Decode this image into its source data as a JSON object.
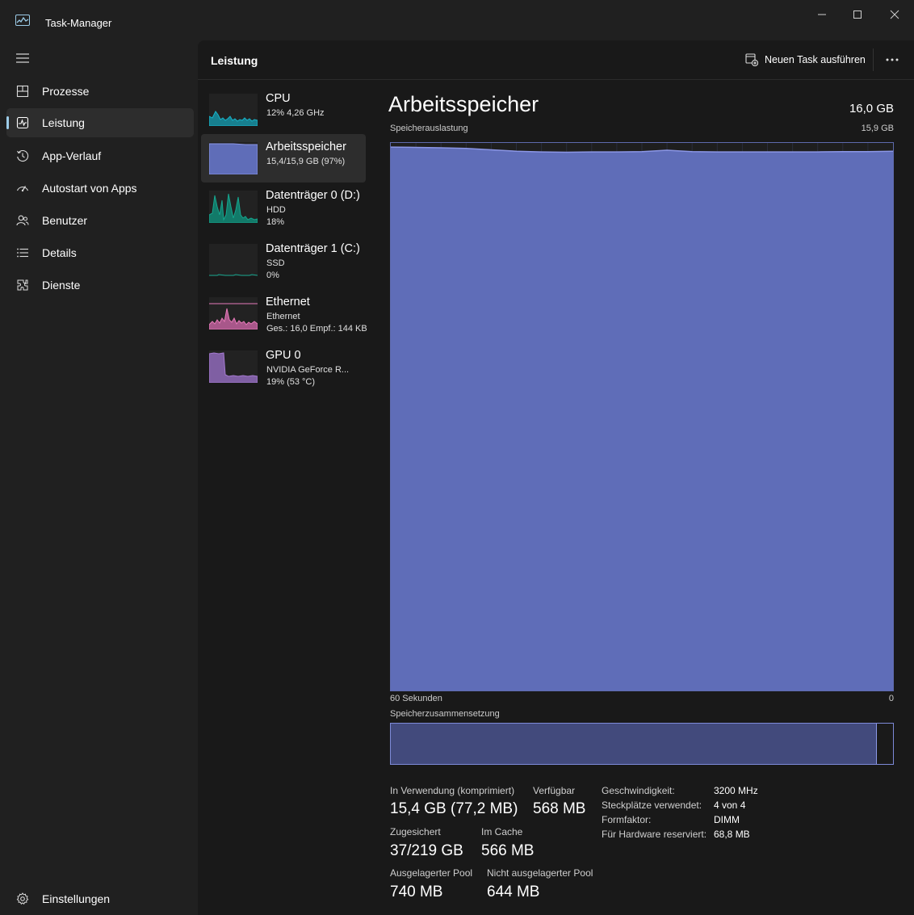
{
  "window": {
    "title": "Task-Manager",
    "icon": "task-manager-icon"
  },
  "sidebar": {
    "items": [
      {
        "label": "Prozesse",
        "icon": "processes-icon"
      },
      {
        "label": "Leistung",
        "icon": "performance-icon",
        "active": true
      },
      {
        "label": "App-Verlauf",
        "icon": "history-icon"
      },
      {
        "label": "Autostart von Apps",
        "icon": "startup-icon"
      },
      {
        "label": "Benutzer",
        "icon": "users-icon"
      },
      {
        "label": "Details",
        "icon": "details-icon"
      },
      {
        "label": "Dienste",
        "icon": "services-icon"
      }
    ],
    "settings": {
      "label": "Einstellungen",
      "icon": "gear-icon"
    }
  },
  "header": {
    "title": "Leistung",
    "new_task_label": "Neuen Task ausführen"
  },
  "resources": [
    {
      "name": "CPU",
      "sub1": "12%  4,26 GHz",
      "sub2": "",
      "color": "#17b3c8"
    },
    {
      "name": "Arbeitsspeicher",
      "sub1": "15,4/15,9 GB (97%)",
      "sub2": "",
      "color": "#6f7ee0"
    },
    {
      "name": "Datenträger 0 (D:)",
      "sub1": "HDD",
      "sub2": "18%",
      "color": "#16a58e"
    },
    {
      "name": "Datenträger 1 (C:)",
      "sub1": "SSD",
      "sub2": "0%",
      "color": "#16a58e"
    },
    {
      "name": "Ethernet",
      "sub1": "Ethernet",
      "sub2": "Ges.: 16,0 Empf.: 144 KB",
      "color": "#e77ab9"
    },
    {
      "name": "GPU 0",
      "sub1": "NVIDIA GeForce R...",
      "sub2": "19%  (53 °C)",
      "color": "#a57bd1"
    }
  ],
  "detail": {
    "title": "Arbeitsspeicher",
    "total": "16,0 GB",
    "graph_label": "Speicherauslastung",
    "graph_max": "15,9 GB",
    "time_left": "60 Sekunden",
    "time_right": "0",
    "composition_label": "Speicherzusammensetzung",
    "composition_used_fraction": 0.968,
    "fill_color": "#5f6db8",
    "line_color": "#8b96e6"
  },
  "chart_data": {
    "type": "area",
    "x": [
      60,
      57,
      54,
      51,
      48,
      45,
      42,
      39,
      36,
      33,
      30,
      27,
      24,
      21,
      18,
      15,
      12,
      9,
      6,
      3,
      0
    ],
    "values": [
      15.78,
      15.77,
      15.76,
      15.74,
      15.7,
      15.66,
      15.64,
      15.63,
      15.64,
      15.64,
      15.65,
      15.69,
      15.65,
      15.64,
      15.64,
      15.64,
      15.64,
      15.64,
      15.65,
      15.65,
      15.66
    ],
    "ylim": [
      0,
      15.9
    ],
    "xlabel": "60 Sekunden",
    "ylabel": "Speicherauslastung",
    "grid": true
  },
  "stats": {
    "in_use_label": "In Verwendung (komprimiert)",
    "in_use_value": "15,4 GB (77,2 MB)",
    "available_label": "Verfügbar",
    "available_value": "568 MB",
    "committed_label": "Zugesichert",
    "committed_value": "37/219 GB",
    "cached_label": "Im Cache",
    "cached_value": "566 MB",
    "paged_label": "Ausgelagerter Pool",
    "paged_value": "740 MB",
    "nonpaged_label": "Nicht ausgelagerter Pool",
    "nonpaged_value": "644 MB"
  },
  "specs": [
    {
      "key": "Geschwindigkeit:",
      "value": "3200 MHz"
    },
    {
      "key": "Steckplätze verwendet:",
      "value": "4 von 4"
    },
    {
      "key": "Formfaktor:",
      "value": "DIMM"
    },
    {
      "key": "Für Hardware reserviert:",
      "value": "68,8 MB"
    }
  ]
}
